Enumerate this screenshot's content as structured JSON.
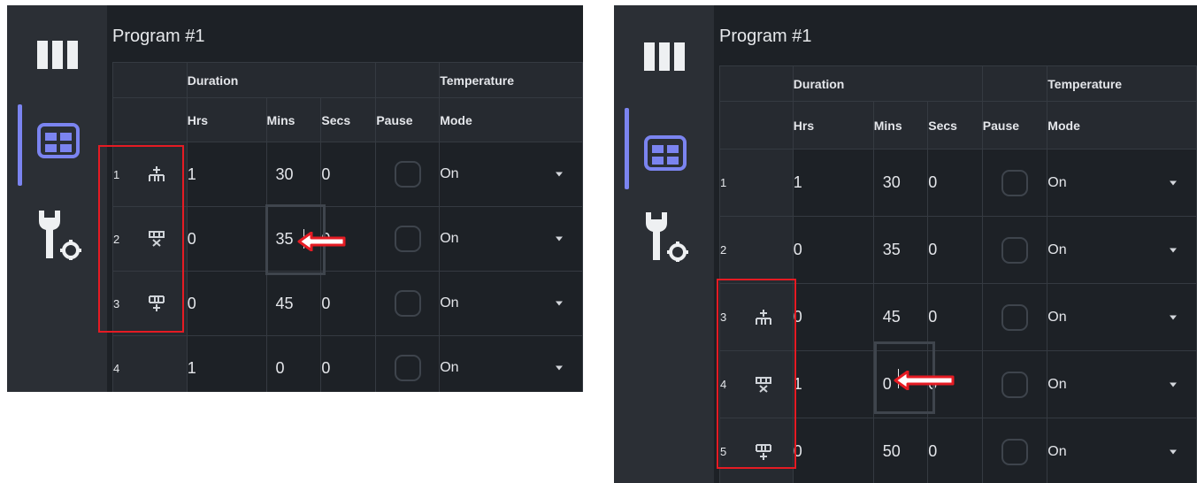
{
  "colors": {
    "panel_bg": "#1d2126",
    "sidebar_bg": "#2b2f35",
    "accent": "#7b84f0",
    "highlight_red": "#e51b23"
  },
  "icons": {
    "sidebar": [
      "columns-icon",
      "table-icon",
      "tools-settings-icon"
    ],
    "rows": [
      "insert-row-above-icon",
      "delete-row-icon",
      "insert-row-below-icon"
    ]
  },
  "left": {
    "title": "Program #1",
    "headers": {
      "duration": "Duration",
      "temperature": "Temperature",
      "hrs": "Hrs",
      "mins": "Mins",
      "secs": "Secs",
      "pause": "Pause",
      "mode": "Mode"
    },
    "rows": [
      {
        "num": "1",
        "hrs": "1",
        "mins": "30",
        "secs": "0",
        "mode": "On"
      },
      {
        "num": "2",
        "hrs": "0",
        "mins": "35",
        "secs": "0",
        "mode": "On"
      },
      {
        "num": "3",
        "hrs": "0",
        "mins": "45",
        "secs": "0",
        "mode": "On"
      },
      {
        "num": "4",
        "hrs": "1",
        "mins": "0",
        "secs": "0",
        "mode": "On"
      }
    ]
  },
  "right": {
    "title": "Program #1",
    "headers": {
      "duration": "Duration",
      "temperature": "Temperature",
      "hrs": "Hrs",
      "mins": "Mins",
      "secs": "Secs",
      "pause": "Pause",
      "mode": "Mode"
    },
    "rows": [
      {
        "num": "1",
        "hrs": "1",
        "mins": "30",
        "secs": "0",
        "mode": "On"
      },
      {
        "num": "2",
        "hrs": "0",
        "mins": "35",
        "secs": "0",
        "mode": "On"
      },
      {
        "num": "3",
        "hrs": "0",
        "mins": "45",
        "secs": "0",
        "mode": "On"
      },
      {
        "num": "4",
        "hrs": "1",
        "mins": "0",
        "secs": "0",
        "mode": "On"
      },
      {
        "num": "5",
        "hrs": "0",
        "mins": "50",
        "secs": "0",
        "mode": "On"
      }
    ]
  }
}
